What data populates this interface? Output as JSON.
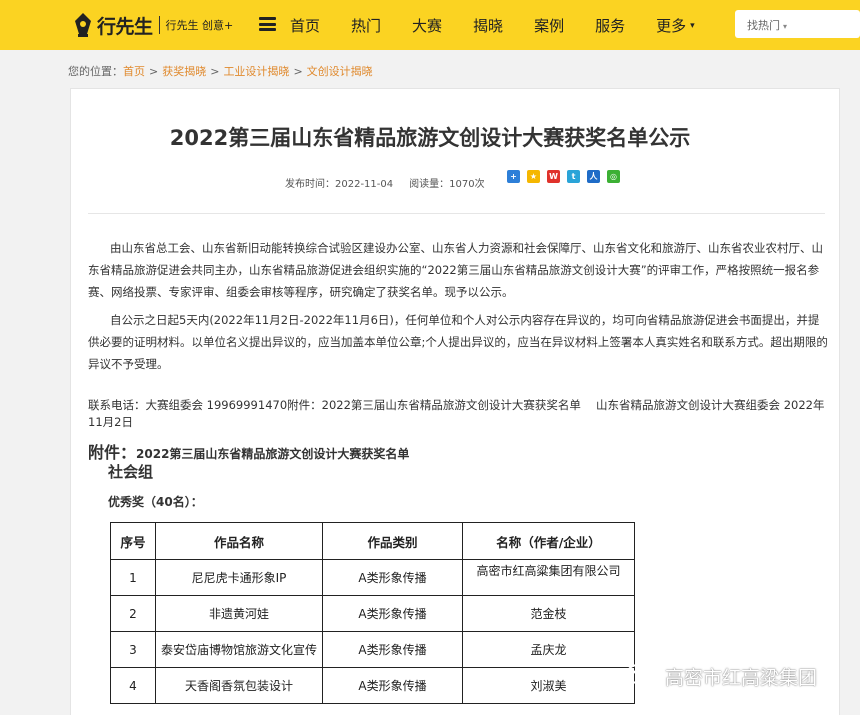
{
  "header": {
    "logo_text": "行先生",
    "logo_sub": "行先生 创意+",
    "nav": [
      "首页",
      "热门",
      "大赛",
      "揭晓",
      "案例",
      "服务",
      "更多"
    ],
    "nav_more_caret": "▾",
    "search_text": "找热门",
    "search_caret": "▾"
  },
  "breadcrumb": {
    "prefix": "您的位置：",
    "items": [
      "首页",
      "获奖揭晓",
      "工业设计揭晓",
      "文创设计揭晓"
    ],
    "separator": ">"
  },
  "article": {
    "title": "2022第三届山东省精品旅游文创设计大赛获奖名单公示",
    "publish_label": "发布时间：2022-11-04",
    "views_label": "阅读量：1070次",
    "share_icons": [
      "share-plus-icon",
      "qzone-icon",
      "weibo-icon",
      "tencent-weibo-icon",
      "renren-icon",
      "wechat-icon"
    ],
    "paragraph1": "由山东省总工会、山东省新旧动能转换综合试验区建设办公室、山东省人力资源和社会保障厅、山东省文化和旅游厅、山东省农业农村厅、山东省精品旅游促进会共同主办，山东省精品旅游促进会组织实施的“2022第三届山东省精品旅游文创设计大赛”的评审工作，严格按照统一报名参赛、网络投票、专家评审、组委会审核等程序，研究确定了获奖名单。现予以公示。",
    "paragraph2": "自公示之日起5天内(2022年11月2日-2022年11月6日)，任何单位和个人对公示内容存在异议的，均可向省精品旅游促进会书面提出，并提供必要的证明材料。以单位名义提出异议的，应当加盖本单位公章;个人提出异议的，应当在异议材料上签署本人真实姓名和联系方式。超出期限的异议不予受理。",
    "contact": "联系电话：大赛组委会 19969991470附件：2022第三届山东省精品旅游文创设计大赛获奖名单　 山东省精品旅游文创设计大赛组委会  2022年11月2日",
    "attach_label": "附件：",
    "attach_title": "2022第三届山东省精品旅游文创设计大赛获奖名单",
    "group_title": "社会组",
    "award_title": "优秀奖（40名）："
  },
  "table": {
    "headers": [
      "序号",
      "作品名称",
      "作品类别",
      "名称（作者/企业）"
    ],
    "rows": [
      [
        "1",
        "尼尼虎卡通形象IP",
        "A类形象传播",
        "高密市红高粱集团有限公司"
      ],
      [
        "2",
        "非遗黄河娃",
        "A类形象传播",
        "范金枝"
      ],
      [
        "3",
        "泰安岱庙博物馆旅游文化宣传",
        "A类形象传播",
        "孟庆龙"
      ],
      [
        "4",
        "天香阁香氛包装设计",
        "A类形象传播",
        "刘淑美"
      ]
    ]
  },
  "watermark": "高密市红高粱集团",
  "colors": {
    "header_bg": "#fbd322",
    "link": "#e08a2e"
  }
}
